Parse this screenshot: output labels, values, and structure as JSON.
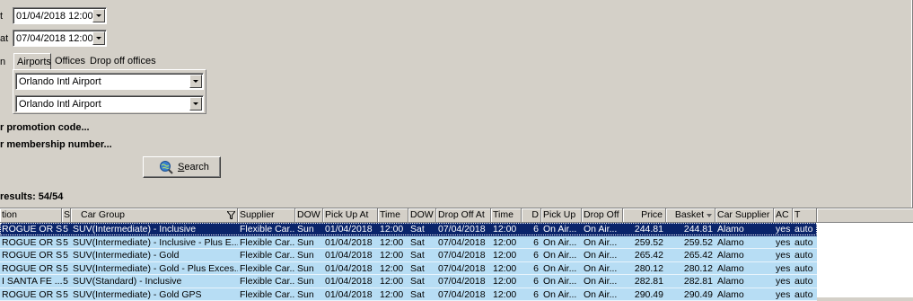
{
  "form": {
    "pickup_label": "t",
    "pickup_value": "01/04/2018 12:00",
    "dropoff_label": "at",
    "dropoff_value": "07/04/2018 12:00",
    "location_label": "n",
    "tabs": [
      {
        "label": "Airports"
      },
      {
        "label": "Offices"
      },
      {
        "label": "Drop off offices"
      }
    ],
    "pickup_location": "Orlando Intl Airport",
    "dropoff_location": "Orlando Intl Airport",
    "promo_link": "r promotion code...",
    "membership_link": "r membership number...",
    "search_label_prefix": "",
    "search_label_underline": "S",
    "search_label_rest": "earch",
    "search_icon": "globe-search-icon"
  },
  "results": {
    "count_text": "results: 54/54"
  },
  "grid": {
    "columns": [
      {
        "label": "tion"
      },
      {
        "label": "S"
      },
      {
        "label": "Car Group"
      },
      {
        "label": "Supplier"
      },
      {
        "label": "DOW"
      },
      {
        "label": "Pick Up At"
      },
      {
        "label": "Time"
      },
      {
        "label": "DOW"
      },
      {
        "label": "Drop Off At"
      },
      {
        "label": "Time"
      },
      {
        "label": "D"
      },
      {
        "label": "Pick Up"
      },
      {
        "label": "Drop Off"
      },
      {
        "label": "Price"
      },
      {
        "label": "Basket"
      },
      {
        "label": "Car Supplier"
      },
      {
        "label": "AC"
      },
      {
        "label": "T"
      }
    ],
    "rows": [
      {
        "cells": [
          "ROGUE OR S...",
          "5",
          "SUV(Intermediate) - Inclusive",
          "Flexible Car...",
          "Sun",
          "01/04/2018",
          "12:00",
          "Sat",
          "07/04/2018",
          "12:00",
          "6",
          "On Air...",
          "On Air...",
          "244.81",
          "244.81",
          "Alamo",
          "yes",
          "auto"
        ],
        "selected": true
      },
      {
        "cells": [
          "ROGUE OR S...",
          "5",
          "SUV(Intermediate) - Inclusive - Plus E...",
          "Flexible Car...",
          "Sun",
          "01/04/2018",
          "12:00",
          "Sat",
          "07/04/2018",
          "12:00",
          "6",
          "On Air...",
          "On Air...",
          "259.52",
          "259.52",
          "Alamo",
          "yes",
          "auto"
        ],
        "selected": false
      },
      {
        "cells": [
          "ROGUE OR S...",
          "5",
          "SUV(Intermediate) - Gold",
          "Flexible Car...",
          "Sun",
          "01/04/2018",
          "12:00",
          "Sat",
          "07/04/2018",
          "12:00",
          "6",
          "On Air...",
          "On Air...",
          "265.42",
          "265.42",
          "Alamo",
          "yes",
          "auto"
        ],
        "selected": false
      },
      {
        "cells": [
          "ROGUE OR S...",
          "5",
          "SUV(Intermediate) - Gold - Plus Exces...",
          "Flexible Car...",
          "Sun",
          "01/04/2018",
          "12:00",
          "Sat",
          "07/04/2018",
          "12:00",
          "6",
          "On Air...",
          "On Air...",
          "280.12",
          "280.12",
          "Alamo",
          "yes",
          "auto"
        ],
        "selected": false
      },
      {
        "cells": [
          "I SANTA FE ...",
          "5",
          "SUV(Standard) - Inclusive",
          "Flexible Car...",
          "Sun",
          "01/04/2018",
          "12:00",
          "Sat",
          "07/04/2018",
          "12:00",
          "6",
          "On Air...",
          "On Air...",
          "282.81",
          "282.81",
          "Alamo",
          "yes",
          "auto"
        ],
        "selected": false
      },
      {
        "cells": [
          "ROGUE OR S...",
          "5",
          "SUV(Intermediate) - Gold GPS",
          "Flexible Car...",
          "Sun",
          "01/04/2018",
          "12:00",
          "Sat",
          "07/04/2018",
          "12:00",
          "6",
          "On Air...",
          "On Air...",
          "290.49",
          "290.49",
          "Alamo",
          "yes",
          "auto"
        ],
        "selected": false
      }
    ]
  },
  "colors": {
    "background": "#d4d0c8",
    "row_highlight": "#b7ddf4",
    "row_selected": "#0a246a"
  }
}
